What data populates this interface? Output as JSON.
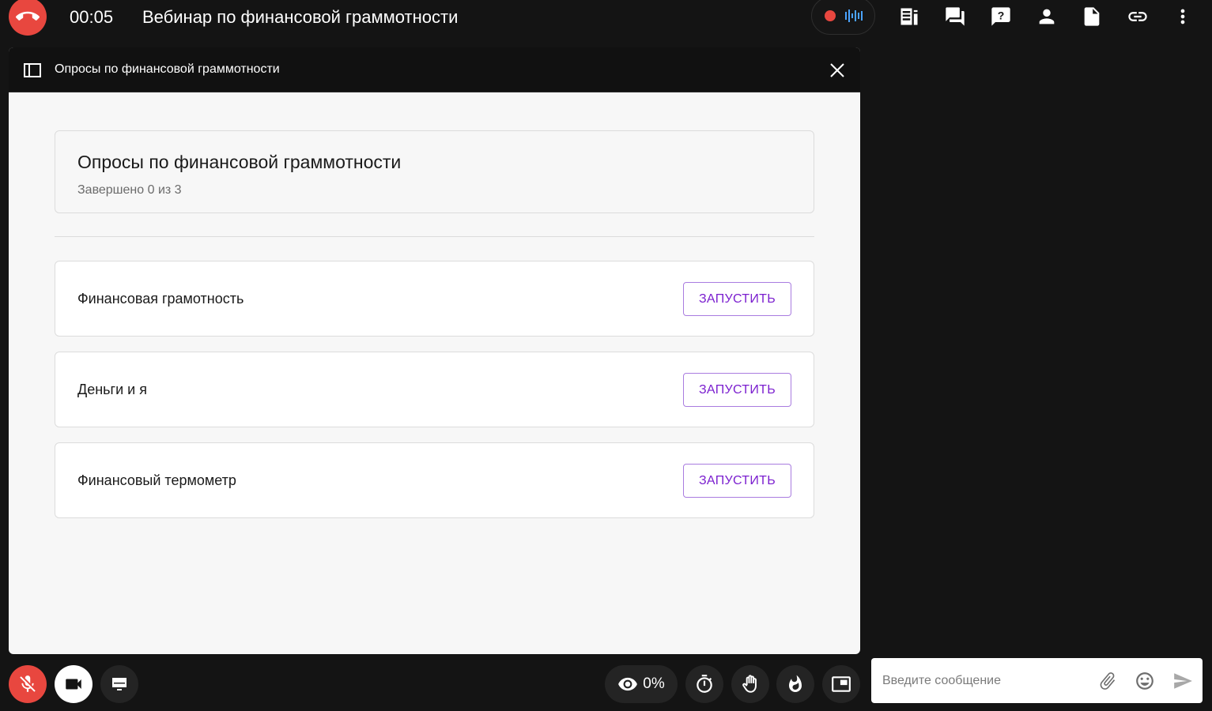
{
  "header": {
    "timer": "00:05",
    "webinar_title": "Вебинар по финансовой граммотности",
    "icons": [
      "hang-up-icon",
      "record-dot-icon",
      "audio-level-icon",
      "agenda-icon",
      "chat-icon",
      "question-icon",
      "participants-icon",
      "document-icon",
      "link-icon",
      "more-vert-icon"
    ]
  },
  "polls_panel": {
    "header_title": "Опросы по финансовой граммотности",
    "summary": {
      "title": "Опросы по финансовой граммотности",
      "progress_text": "Завершено 0 из 3"
    },
    "polls": [
      {
        "title": "Финансовая грамотность",
        "action_label": "ЗАПУСТИТЬ"
      },
      {
        "title": "Деньги и я",
        "action_label": "ЗАПУСТИТЬ"
      },
      {
        "title": "Финансовый термометр",
        "action_label": "ЗАПУСТИТЬ"
      }
    ]
  },
  "bottom_bar": {
    "views_percent": "0%",
    "icons": [
      "mic-off-icon",
      "camera-icon",
      "screen-share-icon",
      "eye-icon",
      "stopwatch-icon",
      "raise-hand-icon",
      "fire-icon",
      "picture-in-picture-icon"
    ]
  },
  "chat": {
    "placeholder": "Введите сообщение",
    "icons": [
      "attach-icon",
      "emoji-icon",
      "send-icon"
    ]
  },
  "colors": {
    "background": "#141414",
    "accent_red": "#e8473f",
    "accent_purple": "#7b1fcf",
    "audio_blue": "#4aa3ff"
  }
}
